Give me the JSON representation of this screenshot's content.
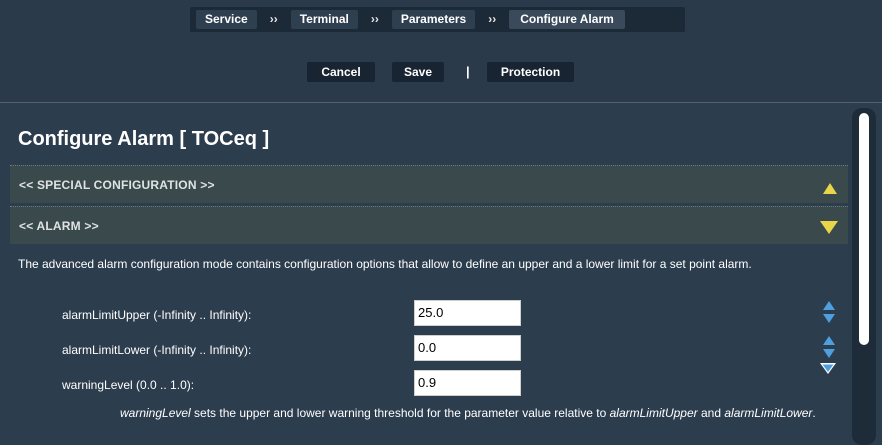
{
  "breadcrumb": {
    "items": [
      "Service",
      "Terminal",
      "Parameters",
      "Configure Alarm"
    ],
    "separator": "››"
  },
  "actions": {
    "cancel": "Cancel",
    "save": "Save",
    "divider": "|",
    "protection": "Protection"
  },
  "page": {
    "title": "Configure Alarm [ TOCeq ]"
  },
  "sections": {
    "special": {
      "label": "<<  SPECIAL CONFIGURATION  >>",
      "state": "collapsed"
    },
    "alarm": {
      "label": "<<  ALARM  >>",
      "state": "expanded"
    }
  },
  "alarm": {
    "description": "The advanced alarm configuration mode contains configuration options that allow to define an upper and a lower limit for a set point alarm.",
    "fields": [
      {
        "label": "alarmLimitUpper (-Infinity .. Infinity):",
        "value": "25.0"
      },
      {
        "label": "alarmLimitLower (-Infinity .. Infinity):",
        "value": "0.0"
      },
      {
        "label": "warningLevel (0.0 .. 1.0):",
        "value": "0.9"
      }
    ],
    "note": {
      "term1": "warningLevel",
      "text1": " sets the upper and lower warning threshold for the parameter value relative to ",
      "term2": "alarmLimitUpper",
      "text2": " and ",
      "term3": "alarmLimitLower",
      "text3": "."
    }
  },
  "colors": {
    "background": "#2c3d4e",
    "section_bg": "#3a4a4c",
    "arrow_yellow": "#e8d54a",
    "arrow_blue": "#4d9fe0"
  }
}
